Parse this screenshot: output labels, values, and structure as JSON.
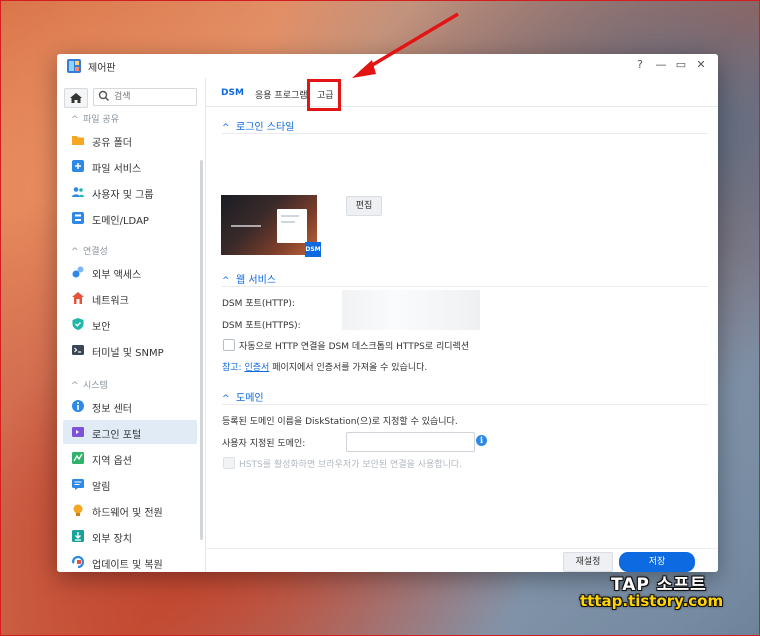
{
  "window": {
    "title": "제어판"
  },
  "window_controls": {
    "help": "?",
    "minimize": "—",
    "maximize": "▭",
    "close": "✕"
  },
  "search": {
    "placeholder": "검색"
  },
  "sidebar": {
    "sections": [
      {
        "title": "파일 공유",
        "items": [
          "공유 폴더",
          "파일 서비스",
          "사용자 및 그룹",
          "도메인/LDAP"
        ]
      },
      {
        "title": "연결성",
        "items": [
          "외부 액세스",
          "네트워크",
          "보안",
          "터미널 및 SNMP"
        ]
      },
      {
        "title": "시스템",
        "items": [
          "정보 센터",
          "로그인 포털",
          "지역 옵션",
          "알림",
          "하드웨어 및 전원",
          "외부 장치",
          "업데이트 및 복원"
        ]
      }
    ],
    "active_item": "로그인 포털"
  },
  "tabs": [
    "DSM",
    "응용 프로그램",
    "고급"
  ],
  "active_tab": "DSM",
  "login_style": {
    "title": "로그인 스타일",
    "badge": "DSM",
    "edit_label": "편집"
  },
  "web_service": {
    "title": "웹 서비스",
    "http_label": "DSM 포트(HTTP):",
    "https_label": "DSM 포트(HTTPS):",
    "redirect_label": "자동으로 HTTP 연결을 DSM 데스크톱의 HTTPS로 리디렉션",
    "note_prefix": "참고:",
    "note_link": "인증서",
    "note_suffix": "페이지에서 인증서를 가져올 수 있습니다."
  },
  "domain": {
    "title": "도메인",
    "description": "등록된 도메인 이름을 DiskStation(으)로 지정할 수 있습니다.",
    "custom_label": "사용자 지정된 도메인:",
    "custom_value": "",
    "hsts_label": "HSTS를 활성화하면 브라우저가 보안된 연결을 사용합니다."
  },
  "footer": {
    "reset_label": "재설정",
    "save_label": "저장"
  },
  "watermark": {
    "line1": "TAP 소프트",
    "line2": "tttap.tistory.com"
  },
  "colors": {
    "accent": "#0d6ae0",
    "highlight": "#e21414",
    "active_nav": "#e1ebf6"
  }
}
